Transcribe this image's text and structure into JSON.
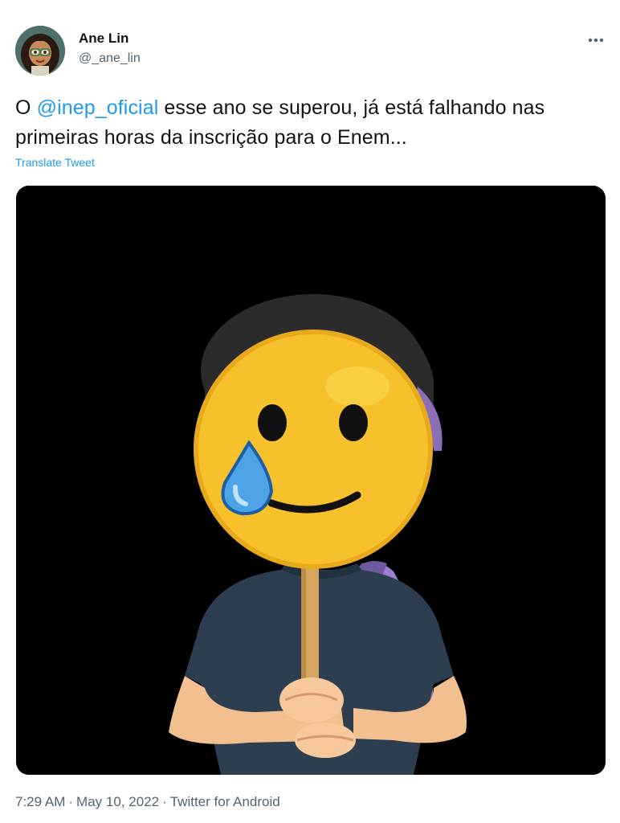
{
  "author": {
    "display_name": "Ane Lin",
    "handle": "@_ane_lin",
    "avatar_icon": "cartoon-girl-avatar"
  },
  "tweet": {
    "text_prefix": "O ",
    "mention": "@inep_oficial",
    "text_suffix": " esse ano se superou, já está falhando nas primeiras horas da inscrição para o Enem...",
    "translate_label": "Translate Tweet",
    "media_icon": "bitmoji-crying-smiley-mask-image"
  },
  "meta": {
    "time": "7:29 AM",
    "separator": "·",
    "date": "May 10, 2022",
    "source": "Twitter for Android"
  },
  "more_icon": "more-options-icon",
  "colors": {
    "accent": "#1d9bf0",
    "text_primary": "#0f1419",
    "text_secondary": "#536471",
    "media_bg": "#000000",
    "emoji_yellow": "#f6c12a"
  }
}
